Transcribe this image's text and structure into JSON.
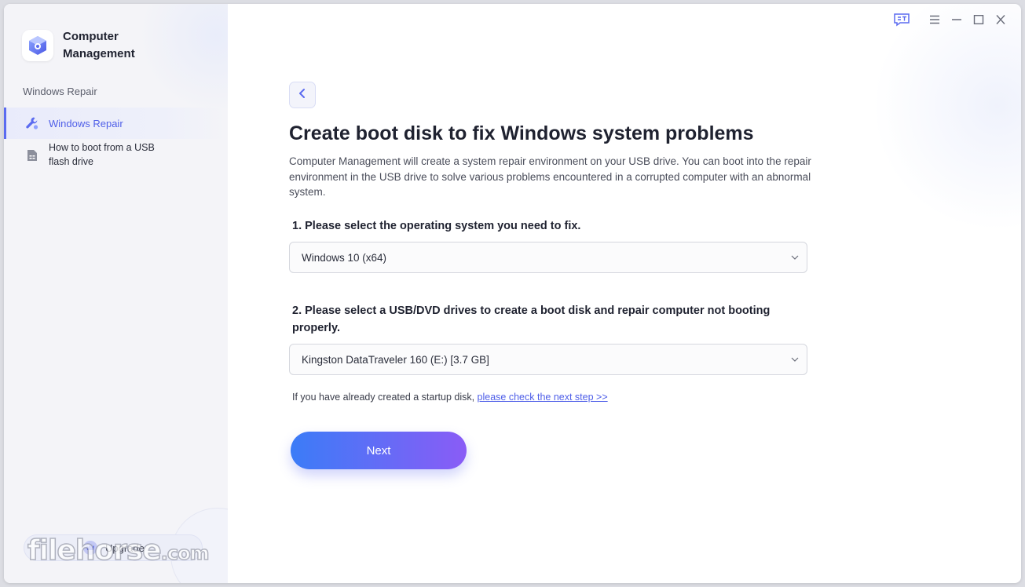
{
  "app": {
    "name": "Computer Management"
  },
  "sidebar": {
    "section_label": "Windows Repair",
    "items": [
      {
        "label": "Windows Repair",
        "icon": "wrench-icon",
        "active": true
      },
      {
        "label": "How to boot from a USB flash drive",
        "icon": "document-icon",
        "active": false
      }
    ],
    "upgrade_label": "Upgrade",
    "watermark": "filehorse",
    "watermark_suffix": ".com"
  },
  "main": {
    "title": "Create boot disk to fix Windows system problems",
    "description": "Computer Management will create a system repair environment on your USB drive. You can boot into the repair environment in the USB drive to solve various problems encountered in a corrupted computer with an abnormal system.",
    "step1_label": "1. Please select the operating system you need to fix.",
    "step1_value": "Windows 10 (x64)",
    "step2_label": "2. Please select a USB/DVD drives to create a boot disk and repair computer not booting properly.",
    "step2_value": "Kingston DataTraveler 160 (E:) [3.7 GB]",
    "hint_text": "If you have already created a startup disk, ",
    "hint_link": "please check the next step >>",
    "next_label": "Next"
  },
  "colors": {
    "accent": "#4f5fe8",
    "button_gradient_start": "#3b7cf7",
    "button_gradient_end": "#8a5cf6",
    "sidebar_bg": "#f4f4f8"
  }
}
